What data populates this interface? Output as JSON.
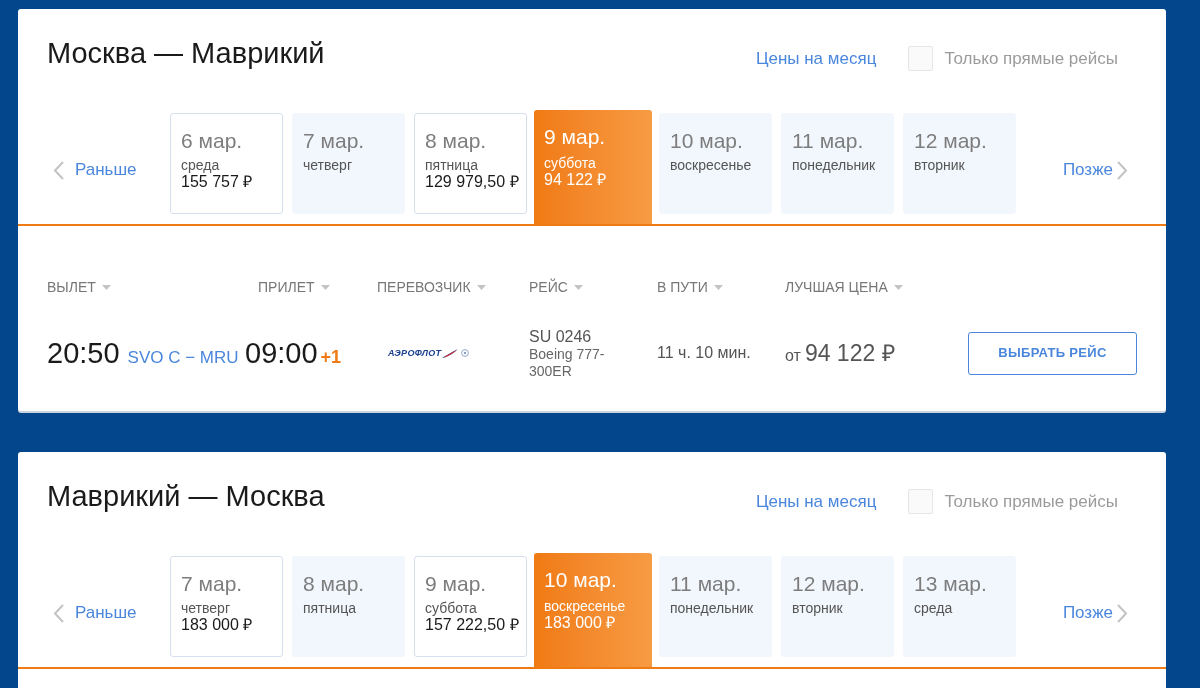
{
  "directions": [
    {
      "title": "Москва — Маврикий",
      "month_prices": "Цены на месяц",
      "direct_only": {
        "label": "Только прямые рейсы",
        "checked": false
      },
      "earlier": "Раньше",
      "later": "Позже",
      "dates": [
        {
          "date": "6 мар.",
          "weekday": "среда",
          "price": "155 757 ₽",
          "selected": false
        },
        {
          "date": "7 мар.",
          "weekday": "четверг",
          "selected": false
        },
        {
          "date": "8 мар.",
          "weekday": "пятница",
          "price": "129 979,50 ₽",
          "selected": false
        },
        {
          "date": "9 мар.",
          "weekday": "суббота",
          "price": "94 122 ₽",
          "selected": true
        },
        {
          "date": "10 мар.",
          "weekday": "воскресенье",
          "selected": false
        },
        {
          "date": "11 мар.",
          "weekday": "понедельник",
          "selected": false
        },
        {
          "date": "12 мар.",
          "weekday": "вторник",
          "selected": false
        }
      ],
      "table": {
        "columns": [
          "ВЫЛЕТ",
          "ПРИЛЕТ",
          "ПЕРЕВОЗЧИК",
          "РЕЙС",
          "В ПУТИ",
          "ЛУЧШАЯ ЦЕНА"
        ],
        "rows": [
          {
            "departure_time": "20:50",
            "route": "SVO C − MRU",
            "arrival_time": "09:00",
            "day_shift": "+1",
            "carrier": "АЭРОФЛОТ",
            "flight_number": "SU 0246",
            "aircraft": "Boeing 777-300ER",
            "duration": "11 ч. 10 мин.",
            "price_prefix": "от",
            "price": "94 122 ₽",
            "action": "ВЫБРАТЬ РЕЙС"
          }
        ]
      }
    },
    {
      "title": "Маврикий — Москва",
      "month_prices": "Цены на месяц",
      "direct_only": {
        "label": "Только прямые рейсы",
        "checked": false
      },
      "earlier": "Раньше",
      "later": "Позже",
      "dates": [
        {
          "date": "7 мар.",
          "weekday": "четверг",
          "price": "183 000 ₽",
          "selected": false
        },
        {
          "date": "8 мар.",
          "weekday": "пятница",
          "selected": false
        },
        {
          "date": "9 мар.",
          "weekday": "суббота",
          "price": "157 222,50 ₽",
          "selected": false
        },
        {
          "date": "10 мар.",
          "weekday": "воскресенье",
          "price": "183 000 ₽",
          "selected": true
        },
        {
          "date": "11 мар.",
          "weekday": "понедельник",
          "selected": false
        },
        {
          "date": "12 мар.",
          "weekday": "вторник",
          "selected": false
        },
        {
          "date": "13 мар.",
          "weekday": "среда",
          "selected": false
        }
      ]
    }
  ]
}
